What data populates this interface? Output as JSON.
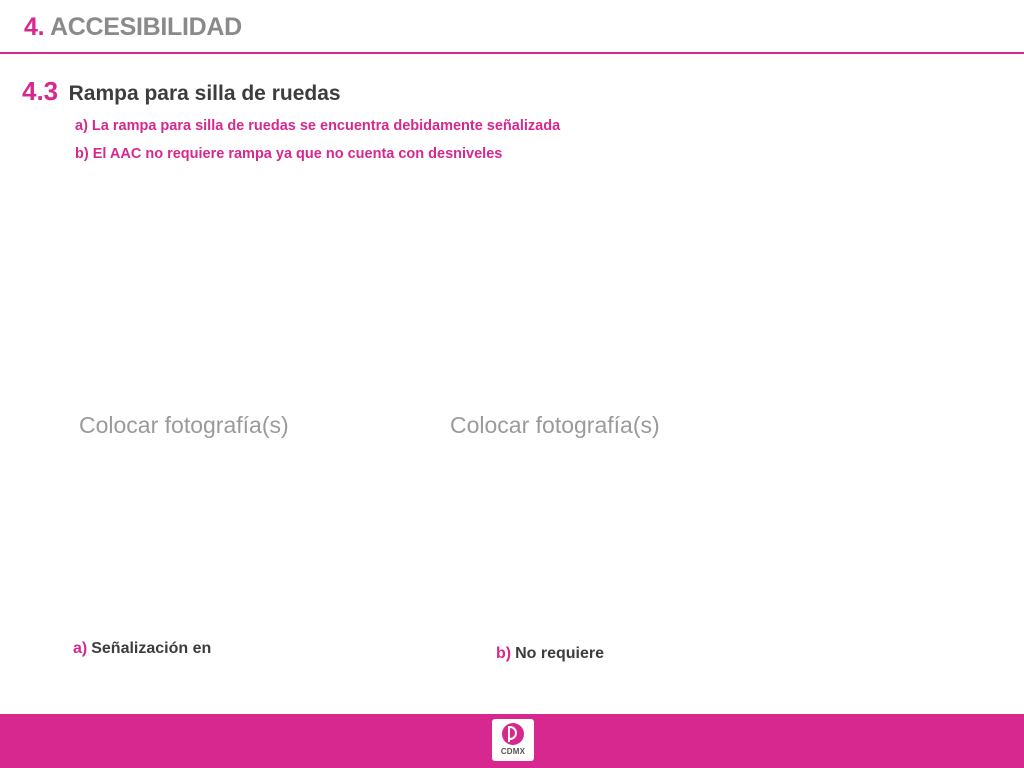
{
  "header": {
    "number": "4.",
    "title": "ACCESIBILIDAD"
  },
  "section": {
    "number": "4.3",
    "title": "Rampa para silla de ruedas",
    "items": [
      "a) La rampa para silla de ruedas se encuentra debidamente señalizada",
      "b) El AAC no requiere rampa ya que no cuenta con desniveles"
    ]
  },
  "photos": {
    "left_placeholder": "Colocar fotografía(s)",
    "right_placeholder": "Colocar fotografía(s)"
  },
  "captions": {
    "a_letter": "a)",
    "a_text": "Señalización en",
    "b_letter": "b)",
    "b_text": "No requiere"
  },
  "footer": {
    "logo_icon": "cdmx-logo-icon",
    "logo_text": "CDMX"
  },
  "colors": {
    "accent": "#d6288f",
    "heading_gray": "#8a8a8a",
    "text_dark": "#3d3d3d",
    "placeholder_gray": "#9a9a9a"
  }
}
